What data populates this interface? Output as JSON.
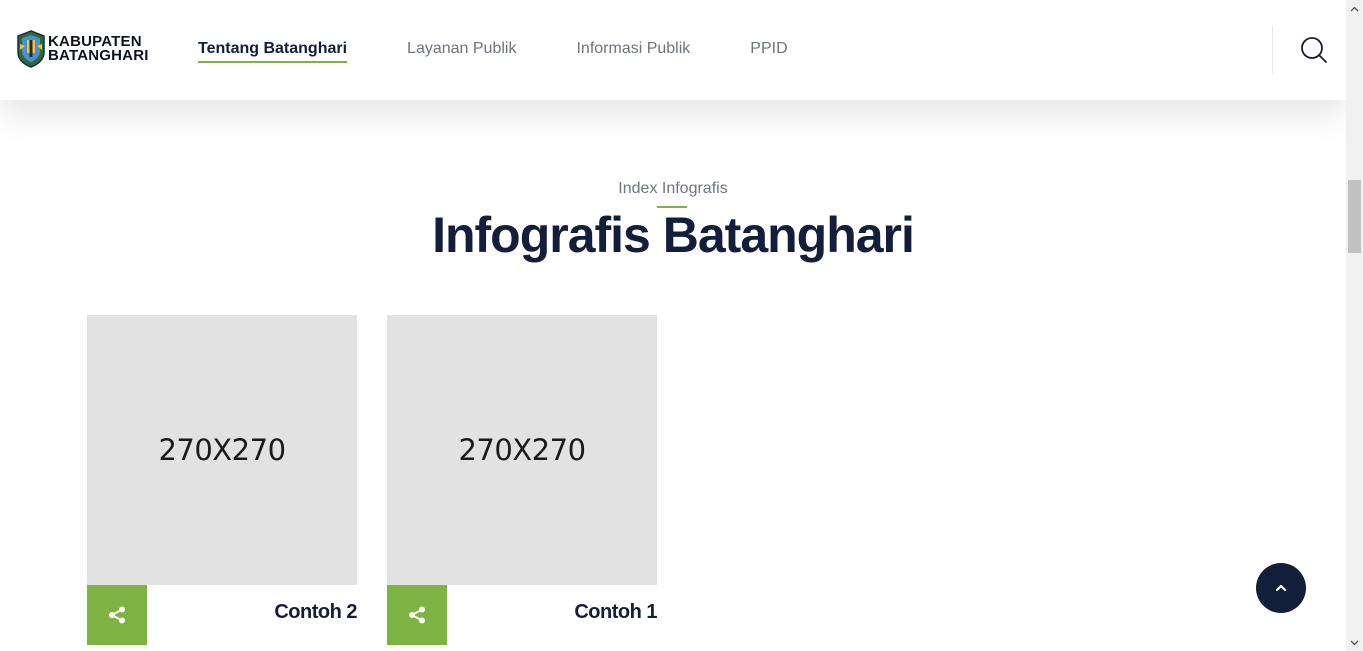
{
  "brand": {
    "line1": "KABUPATEN",
    "line2": "BATANGHARI"
  },
  "nav": {
    "items": [
      {
        "label": "Tentang Batanghari",
        "active": true
      },
      {
        "label": "Layanan Publik",
        "active": false
      },
      {
        "label": "Informasi Publik",
        "active": false
      },
      {
        "label": "PPID",
        "active": false
      }
    ]
  },
  "icons": {
    "search": "search-icon",
    "share": "share-icon",
    "back_to_top": "chevron-up-icon"
  },
  "section": {
    "kicker": "Index Infografis",
    "title": "Infografis Batanghari"
  },
  "cards": [
    {
      "image_text": "270X270",
      "title": "Contoh 2"
    },
    {
      "image_text": "270X270",
      "title": "Contoh 1"
    }
  ],
  "colors": {
    "accent_green": "#7cb342",
    "navy": "#131f3a",
    "muted": "#6f7480",
    "placeholder": "#e2e2e2"
  }
}
